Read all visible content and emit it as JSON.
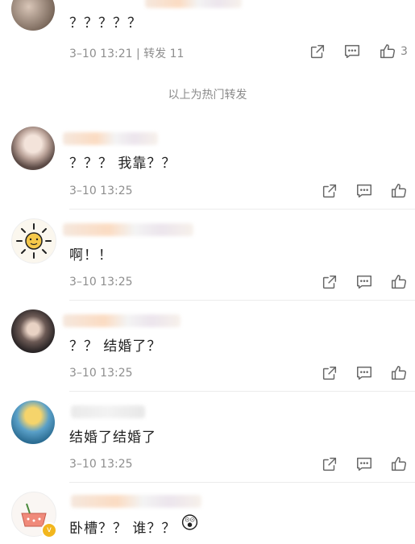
{
  "top_comment": {
    "text": "？？？？？",
    "meta": "3–10 13:21 | 转发 11",
    "like_count": "3"
  },
  "section_label": "以上为热门转发",
  "comments": [
    {
      "text": "？？？ 我靠？？",
      "time": "3–10 13:25"
    },
    {
      "text": "啊！！",
      "time": "3–10 13:25"
    },
    {
      "text": "？？ 结婚了？",
      "time": "3–10 13:25"
    },
    {
      "text": "结婚了结婚了",
      "time": "3–10 13:25"
    },
    {
      "text": "卧槽？？ 谁？？",
      "emoji": "😲"
    }
  ],
  "icons": {
    "share": "share-icon",
    "comment": "comment-icon",
    "like": "like-icon"
  },
  "colors": {
    "meta_text": "#8e8e8e",
    "icon_stroke": "#666666",
    "vip_badge": "#f2b61d"
  }
}
